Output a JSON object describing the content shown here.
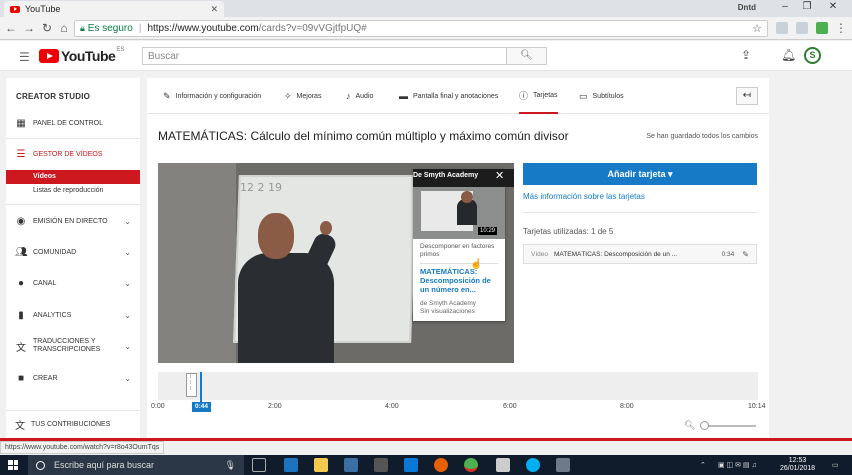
{
  "browser": {
    "tab_title": "YouTube",
    "user": "Dntd",
    "secure_label": "Es seguro",
    "url_host": "https://www.youtube.com",
    "url_path": "/cards?v=09vVGjtfpUQ#",
    "status_url": "https://www.youtube.com/watch?v=r8o43OumTqs"
  },
  "header": {
    "logo": "YouTube",
    "country": "ES",
    "search_placeholder": "Buscar",
    "avatar_letter": "S"
  },
  "sidebar": {
    "title": "CREATOR STUDIO",
    "items": [
      {
        "label": "PANEL DE CONTROL",
        "icon": "dashboard-icon"
      },
      {
        "label": "GESTOR DE VÍDEOS",
        "icon": "video-manager-icon"
      },
      {
        "label": "EMISIÓN EN DIRECTO",
        "icon": "live-icon"
      },
      {
        "label": "COMUNIDAD",
        "icon": "community-icon"
      },
      {
        "label": "CANAL",
        "icon": "channel-icon"
      },
      {
        "label": "ANALYTICS",
        "icon": "analytics-icon"
      },
      {
        "label": "TRADUCCIONES Y",
        "label2": "TRANSCRIPCIONES",
        "icon": "translate-icon"
      },
      {
        "label": "CREAR",
        "icon": "create-icon"
      },
      {
        "label": "TUS CONTRIBUCIONES",
        "icon": "contributions-icon"
      }
    ],
    "subitems": [
      "Vídeos",
      "Listas de reproducción"
    ]
  },
  "editor": {
    "tabs": [
      "Información y configuración",
      "Mejoras",
      "Audio",
      "Pantalla final y anotaciones",
      "Tarjetas",
      "Subtítulos"
    ],
    "active_tab": "Tarjetas",
    "video_title": "MATEMÁTICAS: Cálculo del mínimo común múltiplo y máximo común divisor",
    "saved_status": "Se han guardado todos los cambios"
  },
  "video": {
    "whiteboard_text": "12 2     19",
    "card": {
      "source": "De Smyth Academy",
      "duration": "10:29",
      "teaser": "Descomponer en factores primos",
      "title": "MATEMÁTICAS: Descomposición de un número en...",
      "channel": "de Smyth Academy",
      "views": "Sin visualizaciones"
    }
  },
  "cards_panel": {
    "add_button": "Añadir tarjeta",
    "more_info": "Más información sobre las tarjetas",
    "used": "Tarjetas utilizadas: 1 de 5",
    "rows": [
      {
        "type": "Vídeo",
        "title": "MATEMÁTICAS: Descomposición de un ...",
        "time": "0:34"
      }
    ]
  },
  "timeline": {
    "playhead": "0:44",
    "ticks": [
      "0:00",
      "2:00",
      "4:00",
      "6:00",
      "8:00",
      "10:14"
    ]
  },
  "taskbar": {
    "search_placeholder": "Escribe aquí para buscar",
    "time": "12:53",
    "date": "26/01/2018"
  },
  "colors": {
    "accent": "#cc181e",
    "primary": "#167ac6"
  }
}
